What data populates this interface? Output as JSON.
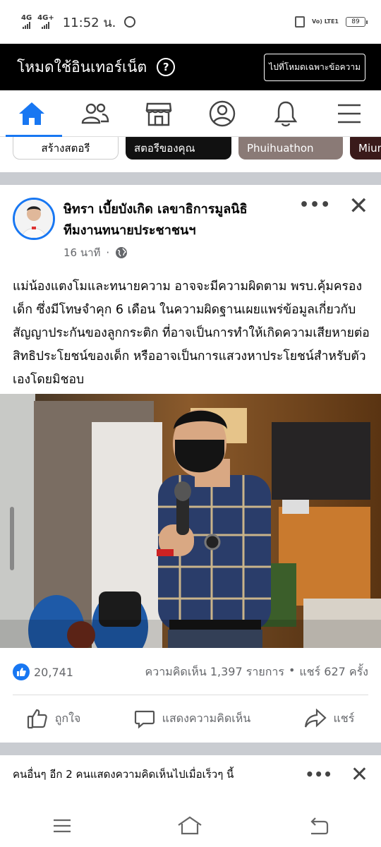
{
  "status_bar": {
    "network1": "4G",
    "network2": "4G+",
    "time": "11:52 น.",
    "volte": "Vo) LTE1",
    "battery": "89"
  },
  "mode_bar": {
    "title": "โหมดใช้อินเทอร์เน็ต",
    "help_icon": "question-icon",
    "switch_button": "ไปที่โหมดเฉพาะข้อความ"
  },
  "nav": {
    "items": [
      {
        "icon": "home-icon",
        "active": true
      },
      {
        "icon": "friends-icon",
        "active": false
      },
      {
        "icon": "marketplace-icon",
        "active": false
      },
      {
        "icon": "profile-icon",
        "active": false
      },
      {
        "icon": "bell-icon",
        "active": false
      },
      {
        "icon": "menu-icon",
        "active": false
      }
    ],
    "accent": "#1877f2"
  },
  "stories": {
    "create": "สร้างสตอรี",
    "yours": "สตอรีของคุณ",
    "person1": "Phuihuathon",
    "person2": "Miun"
  },
  "post": {
    "author_line1": "ษิทรา เบี้ยบังเกิด เลขาธิการมูลนิธิ",
    "author_line2": "ทีมงานทนายประชาชนฯ",
    "time": "16 นาที",
    "dot": "·",
    "text": "แม่น้องแตงโมและทนายความ อาจจะมีความผิดตาม พรบ.คุ้มครองเด็ก ซึ่งมีโทษจำคุก 6 เดือน ในความผิดฐานเผยแพร่ข้อมูลเกี่ยวกับสัญญาประกันของลูกกระติก ที่อาจเป็นการทำให้เกิดความเสียหายต่อสิทธิประโยชน์ของเด็ก หรืออาจเป็นการแสวงหาประโยชน์สำหรับตัวเองโดยมิชอบ",
    "likes": "20,741",
    "comments": "ความคิดเห็น 1,397 รายการ",
    "separator": "•",
    "shares": "แชร์ 627 ครั้ง",
    "actions": {
      "like": "ถูกใจ",
      "comment": "แสดงความคิดเห็น",
      "share": "แชร์"
    }
  },
  "comment_notice": {
    "text": "คนอื่นๆ อีก 2 คนแสดงความคิดเห็นไปเมื่อเร็วๆ นี้"
  }
}
